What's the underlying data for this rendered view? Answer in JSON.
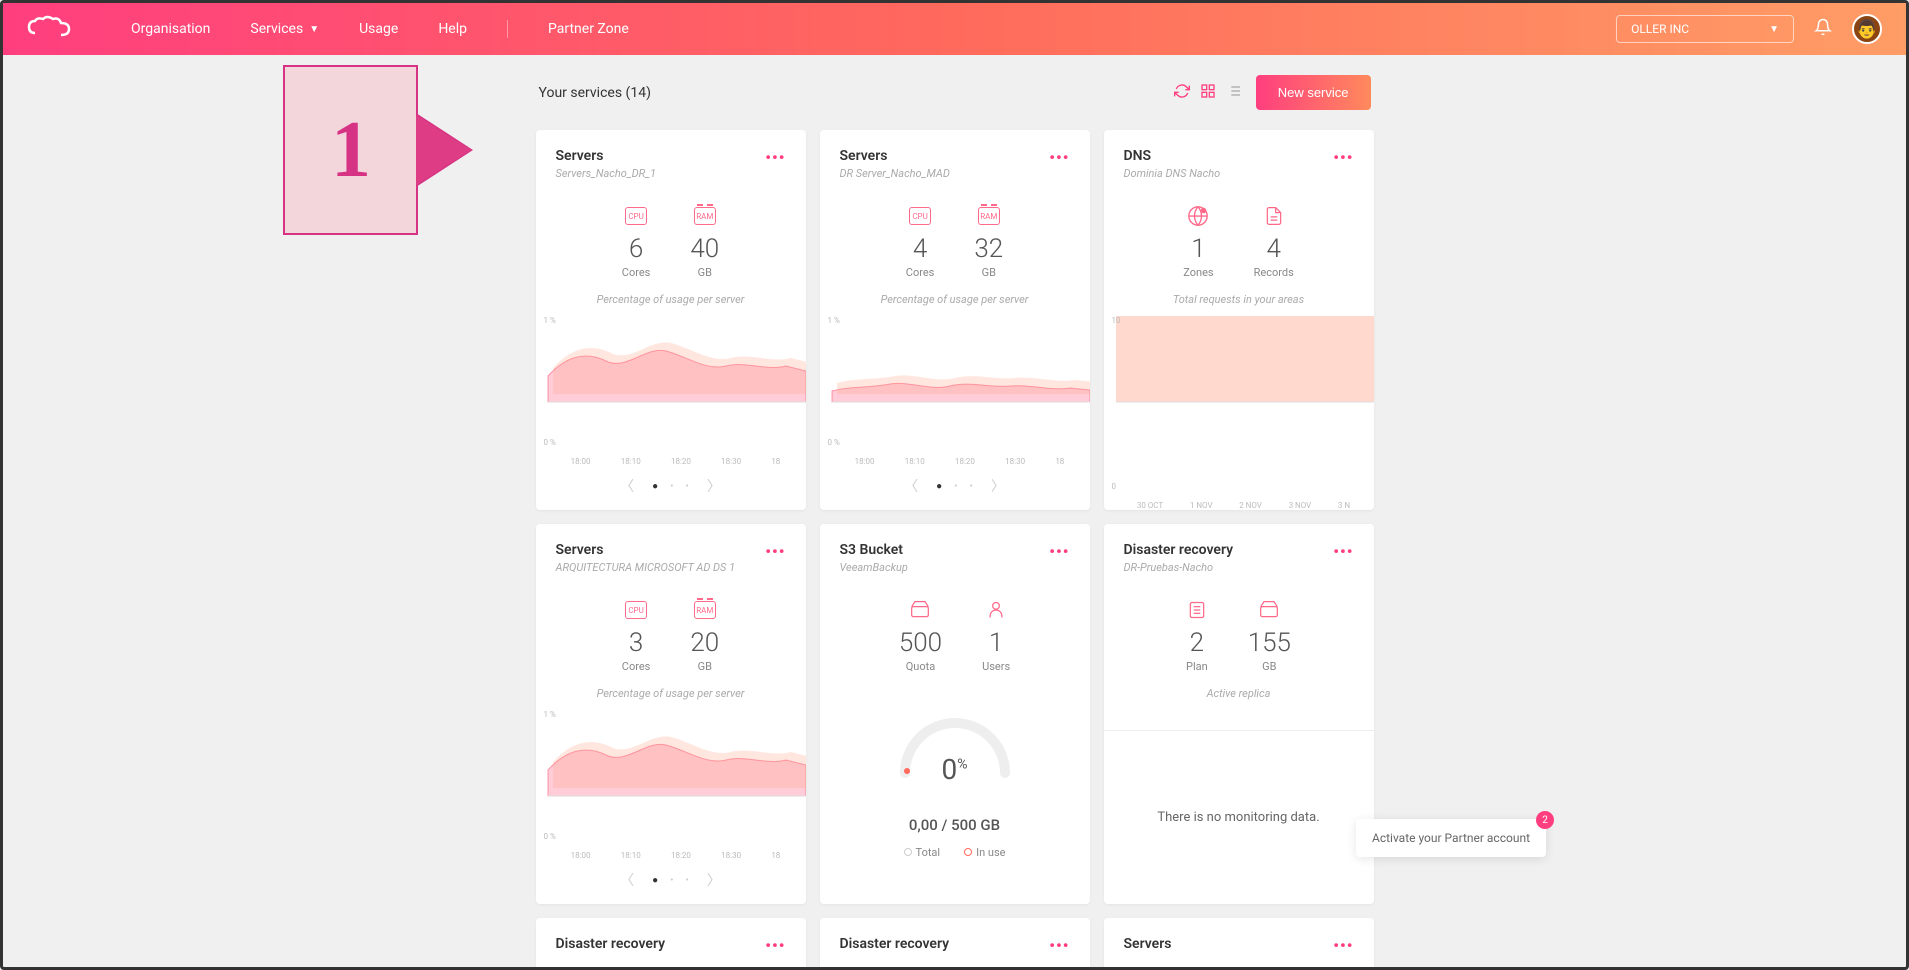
{
  "header": {
    "nav": {
      "organisation": "Organisation",
      "services": "Services",
      "usage": "Usage",
      "help": "Help",
      "partner_zone": "Partner Zone"
    },
    "org_name": "OLLER INC"
  },
  "toolbar": {
    "title": "Your services (14)",
    "new_service": "New service"
  },
  "callout": {
    "number": "1"
  },
  "cards": [
    {
      "title": "Servers",
      "subtitle": "Servers_Nacho_DR_1",
      "stats": [
        {
          "value": "6",
          "label": "Cores",
          "icon": "cpu"
        },
        {
          "value": "40",
          "label": "GB",
          "icon": "ram"
        }
      ],
      "legend": "Percentage of usage per server",
      "yTop": "1 %",
      "yBot": "0 %",
      "xaxis": [
        "18:00",
        "18:10",
        "18:20",
        "18:30",
        "18"
      ],
      "chart": true
    },
    {
      "title": "Servers",
      "subtitle": "DR Server_Nacho_MAD",
      "stats": [
        {
          "value": "4",
          "label": "Cores",
          "icon": "cpu"
        },
        {
          "value": "32",
          "label": "GB",
          "icon": "ram"
        }
      ],
      "legend": "Percentage of usage per server",
      "yTop": "1 %",
      "yBot": "0 %",
      "xaxis": [
        "18:00",
        "18:10",
        "18:20",
        "18:30",
        "18"
      ],
      "chart": true
    },
    {
      "title": "DNS",
      "subtitle": "Dominia DNS Nacho",
      "stats": [
        {
          "value": "1",
          "label": "Zones",
          "icon": "globe"
        },
        {
          "value": "4",
          "label": "Records",
          "icon": "doc"
        }
      ],
      "legend": "Total requests in your areas",
      "yTop": "10",
      "yBot": "0",
      "xaxis": [
        "30 OCT",
        "1 NOV",
        "2 NOV",
        "3 NOV",
        "3 N"
      ],
      "chart": true,
      "flat": true
    },
    {
      "title": "Servers",
      "subtitle": "ARQUITECTURA MICROSOFT AD DS 1",
      "stats": [
        {
          "value": "3",
          "label": "Cores",
          "icon": "cpu"
        },
        {
          "value": "20",
          "label": "GB",
          "icon": "ram"
        }
      ],
      "legend": "Percentage of usage per server",
      "yTop": "1 %",
      "yBot": "0 %",
      "xaxis": [
        "18:00",
        "18:10",
        "18:20",
        "18:30",
        "18"
      ],
      "chart": true
    },
    {
      "title": "S3 Bucket",
      "subtitle": "VeeamBackup",
      "stats": [
        {
          "value": "500",
          "label": "Quota",
          "icon": "drive"
        },
        {
          "value": "1",
          "label": "Users",
          "icon": "user"
        }
      ],
      "gauge": {
        "percent": "0",
        "quota": "0,00 / 500 GB",
        "total": "Total",
        "inuse": "In use"
      }
    },
    {
      "title": "Disaster recovery",
      "subtitle": "DR-Pruebas-Nacho",
      "stats": [
        {
          "value": "2",
          "label": "Plan",
          "icon": "list"
        },
        {
          "value": "155",
          "label": "GB",
          "icon": "drive"
        }
      ],
      "legend": "Active replica",
      "nodata": "There is no monitoring data."
    },
    {
      "title": "Disaster recovery",
      "subtitle": "",
      "short": true
    },
    {
      "title": "Disaster recovery",
      "subtitle": "",
      "short": true
    },
    {
      "title": "Servers",
      "subtitle": "",
      "short": true
    }
  ],
  "toast": {
    "text": "Activate your Partner account",
    "badge": "2"
  }
}
